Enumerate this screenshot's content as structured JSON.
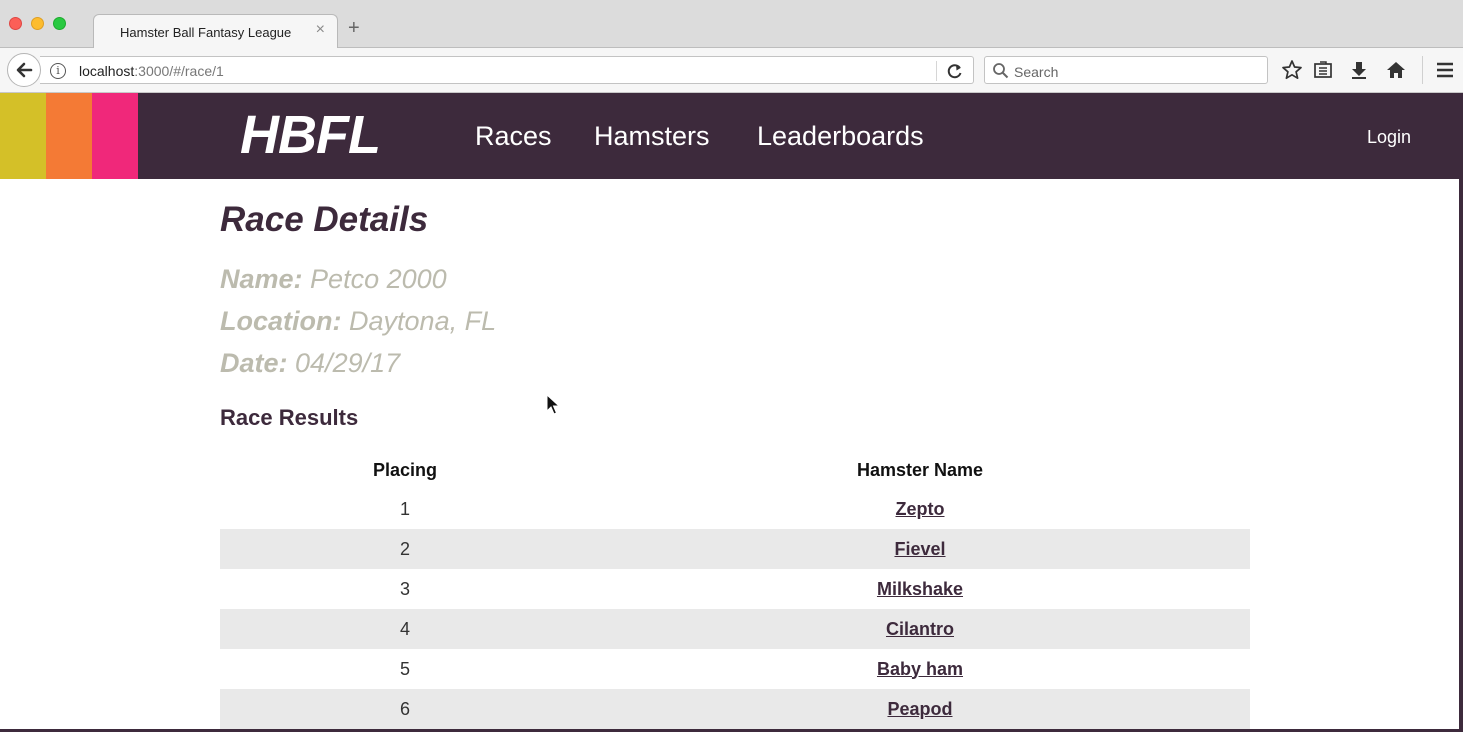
{
  "browser": {
    "tab_title": "Hamster Ball Fantasy League",
    "tab_close": "×",
    "new_tab": "+",
    "url_host": "localhost",
    "url_rest": ":3000/#/race/1",
    "search_placeholder": "Search"
  },
  "site": {
    "brand": "HBFL",
    "stripe_colors": [
      "#d4c028",
      "#f47a35",
      "#f0287a"
    ],
    "header_color": "#3d2a3c",
    "nav": [
      "Races",
      "Hamsters",
      "Leaderboards"
    ],
    "login": "Login"
  },
  "race": {
    "heading": "Race Details",
    "name_label": "Name:",
    "name_value": "Petco 2000",
    "location_label": "Location:",
    "location_value": "Daytona, FL",
    "date_label": "Date:",
    "date_value": "04/29/17"
  },
  "results": {
    "heading": "Race Results",
    "columns": [
      "Placing",
      "Hamster Name"
    ],
    "rows": [
      {
        "placing": "1",
        "name": "Zepto"
      },
      {
        "placing": "2",
        "name": "Fievel"
      },
      {
        "placing": "3",
        "name": "Milkshake"
      },
      {
        "placing": "4",
        "name": "Cilantro"
      },
      {
        "placing": "5",
        "name": "Baby ham"
      },
      {
        "placing": "6",
        "name": "Peapod"
      }
    ]
  }
}
